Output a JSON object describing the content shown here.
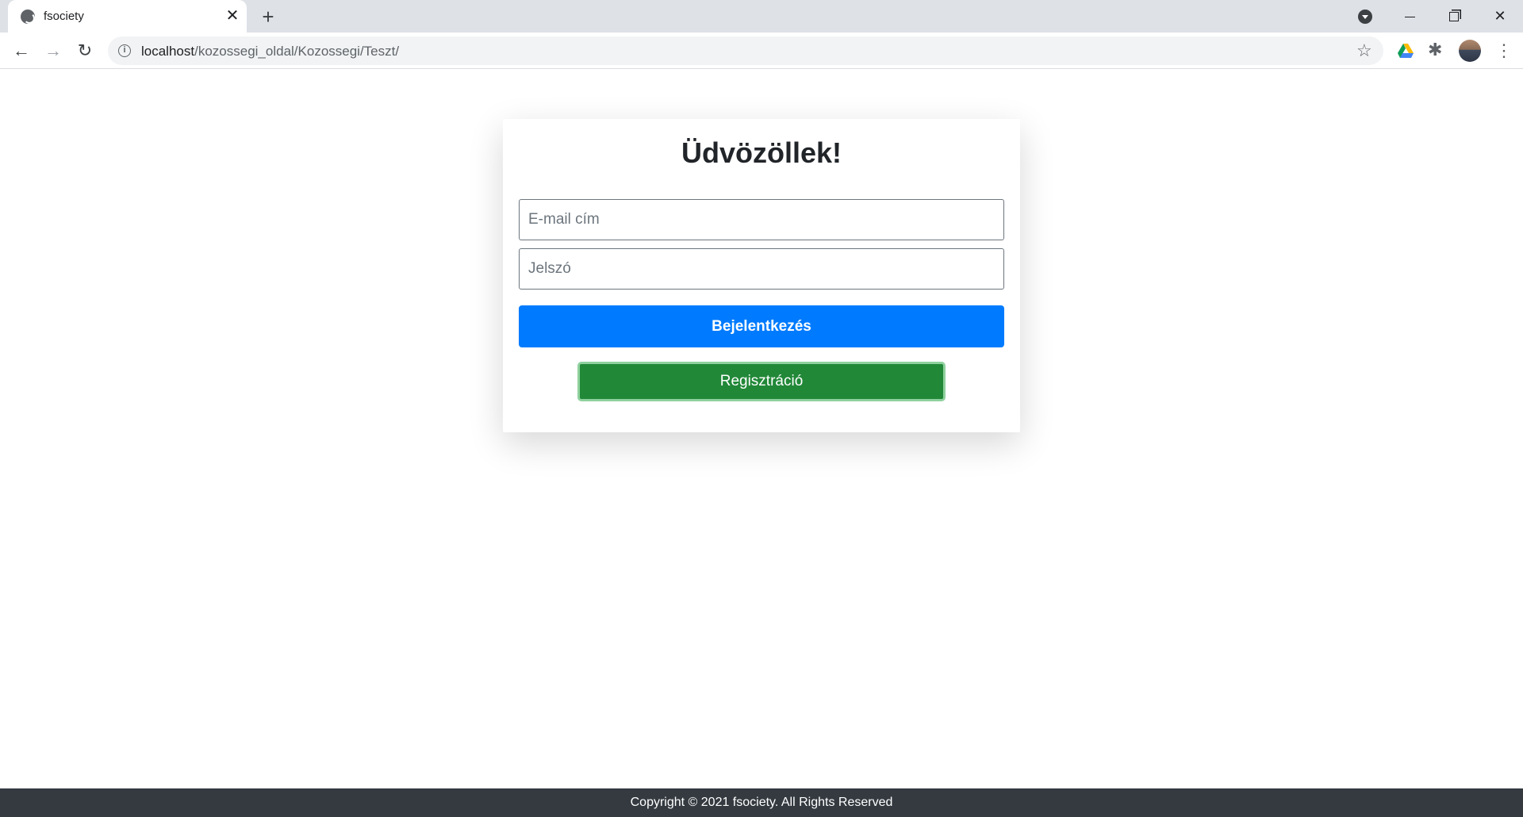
{
  "browser": {
    "tab_title": "fsociety",
    "tab_close": "✕",
    "new_tab": "+",
    "url_host": "localhost",
    "url_path": "/kozossegi_oldal/Kozossegi/Teszt/",
    "icons": {
      "favicon": "globe-icon",
      "back": "←",
      "forward": "→",
      "reload": "↻",
      "info": "i",
      "star": "☆",
      "puzzle": "✱",
      "menu": "⋮",
      "close_window": "✕"
    }
  },
  "login": {
    "title": "Üdvözöllek!",
    "email_placeholder": "E-mail cím",
    "password_placeholder": "Jelszó",
    "login_button": "Bejelentkezés",
    "register_button": "Regisztráció"
  },
  "footer": {
    "text": "Copyright © 2021 fsociety. All Rights Reserved"
  },
  "colors": {
    "primary": "#007bff",
    "success": "#218838",
    "footer_bg": "#343a40"
  }
}
